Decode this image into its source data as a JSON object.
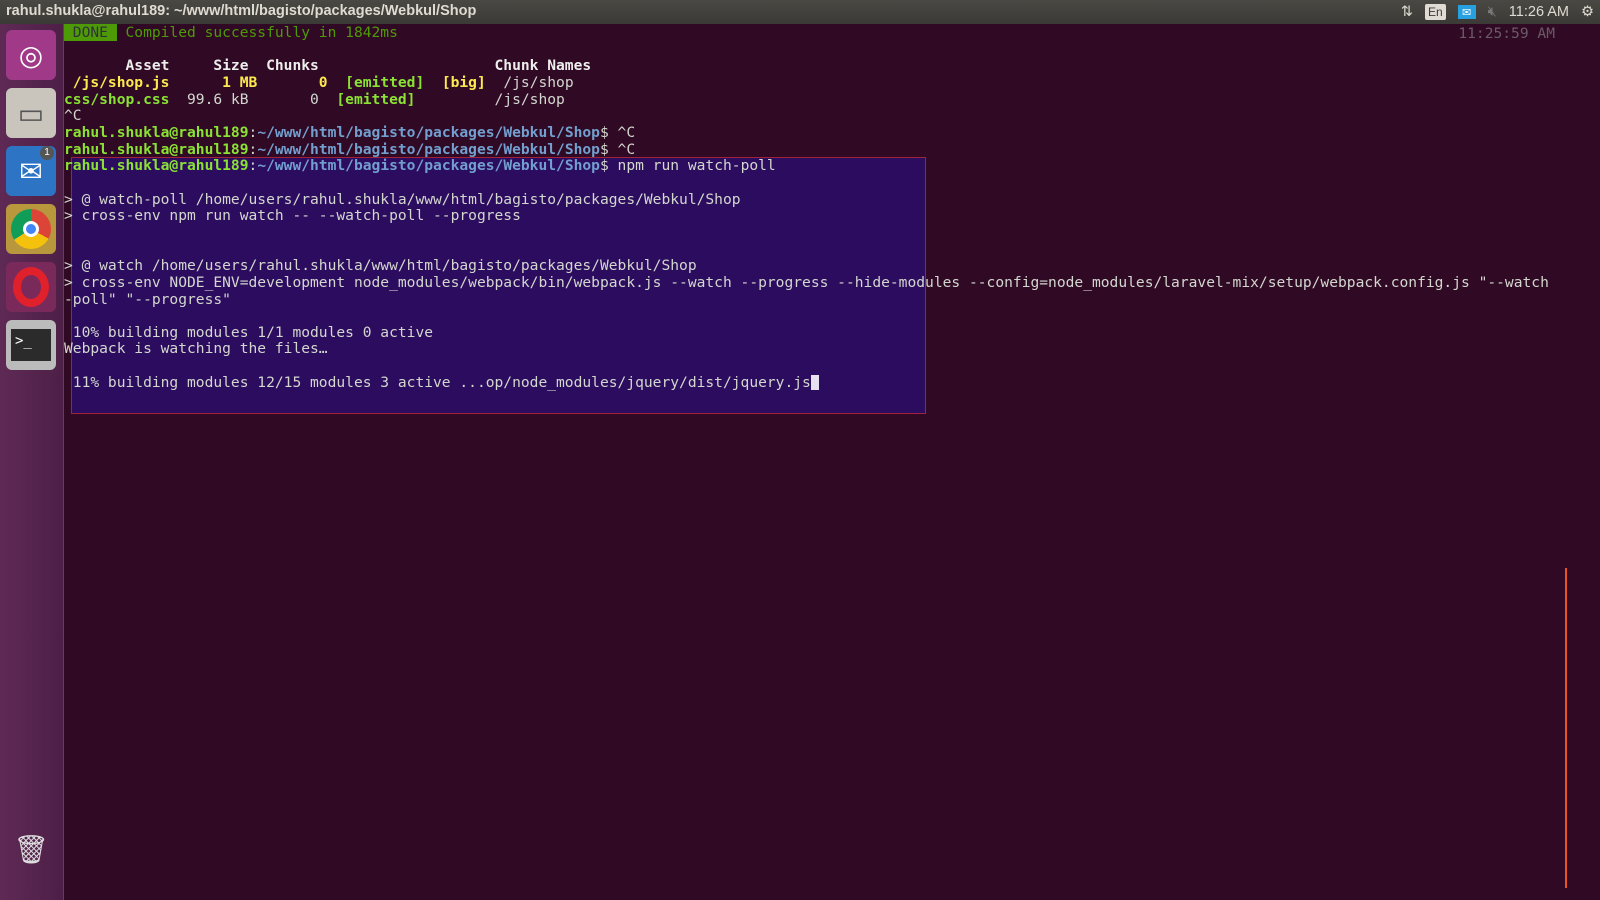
{
  "window": {
    "title": "rahul.shukla@rahul189: ~/www/html/bagisto/packages/Webkul/Shop"
  },
  "tray": {
    "network_icon": "updown-arrows-icon",
    "keyboard": "En",
    "mail_icon": "envelope-icon",
    "volume_icon": "muted-speaker-icon",
    "clock": "11:26 AM",
    "power_icon": "gear-power-icon"
  },
  "launcher": {
    "items": [
      {
        "name": "ubuntu-dash",
        "badge": ""
      },
      {
        "name": "files",
        "badge": ""
      },
      {
        "name": "thunderbird",
        "badge": "1"
      },
      {
        "name": "chrome",
        "badge": ""
      },
      {
        "name": "opera",
        "badge": ""
      },
      {
        "name": "terminal",
        "badge": ""
      },
      {
        "name": "trash",
        "badge": ""
      }
    ]
  },
  "terminal": {
    "timestamp": "11:25:59 AM",
    "lines": [
      [
        {
          "t": " DONE ",
          "c": "done"
        },
        {
          "t": " Compiled successfully in 1842ms",
          "c": "gn"
        }
      ],
      [],
      [
        {
          "t": "       Asset     Size  Chunks                    Chunk Names",
          "c": "w"
        }
      ],
      [
        {
          "t": " /js/shop.js      1 MB       0  ",
          "c": "y"
        },
        {
          "t": "[emitted]",
          "c": "g"
        },
        {
          "t": "  ",
          "c": ""
        },
        {
          "t": "[big]",
          "c": "y"
        },
        {
          "t": "  /js/shop",
          "c": ""
        }
      ],
      [
        {
          "t": "css/shop.css",
          "c": "g"
        },
        {
          "t": "  99.6 kB       0  ",
          "c": ""
        },
        {
          "t": "[emitted]",
          "c": "g"
        },
        {
          "t": "         /js/shop",
          "c": ""
        }
      ],
      [
        {
          "t": "^C",
          "c": ""
        }
      ],
      [
        {
          "t": "rahul.shukla@rahul189",
          "c": "g"
        },
        {
          "t": ":",
          "c": ""
        },
        {
          "t": "~/www/html/bagisto/packages/Webkul/Shop",
          "c": "b"
        },
        {
          "t": "$ ^C",
          "c": ""
        }
      ],
      [
        {
          "t": "rahul.shukla@rahul189",
          "c": "g"
        },
        {
          "t": ":",
          "c": ""
        },
        {
          "t": "~/www/html/bagisto/packages/Webkul/Shop",
          "c": "b"
        },
        {
          "t": "$ ^C",
          "c": ""
        }
      ],
      [
        {
          "t": "rahul.shukla@rahul189",
          "c": "g"
        },
        {
          "t": ":",
          "c": ""
        },
        {
          "t": "~/www/html/bagisto/packages/Webkul/Shop",
          "c": "b"
        },
        {
          "t": "$ npm run watch-poll",
          "c": ""
        }
      ],
      [],
      [
        {
          "t": "> @ watch-poll /home/users/rahul.shukla/www/html/bagisto/packages/Webkul/Shop",
          "c": ""
        }
      ],
      [
        {
          "t": "> cross-env npm run watch -- --watch-poll --progress",
          "c": ""
        }
      ],
      [],
      [],
      [
        {
          "t": "> @ watch /home/users/rahul.shukla/www/html/bagisto/packages/Webkul/Shop",
          "c": ""
        }
      ],
      [
        {
          "t": "> cross-env NODE_ENV=development node_modules/webpack/bin/webpack.js --watch --progress --hide-modules --config=node_modules/laravel-mix/setup/webpack.config.js \"--watch",
          "c": ""
        }
      ],
      [
        {
          "t": "-poll\" \"--progress\"",
          "c": ""
        }
      ],
      [],
      [
        {
          "t": " 10% building modules 1/1 modules 0 active",
          "c": ""
        }
      ],
      [
        {
          "t": "Webpack is watching the files…",
          "c": ""
        }
      ],
      [],
      [
        {
          "t": " 11% building modules 12/15 modules 3 active ...op/node_modules/jquery/dist/jquery.js",
          "c": ""
        }
      ]
    ]
  }
}
